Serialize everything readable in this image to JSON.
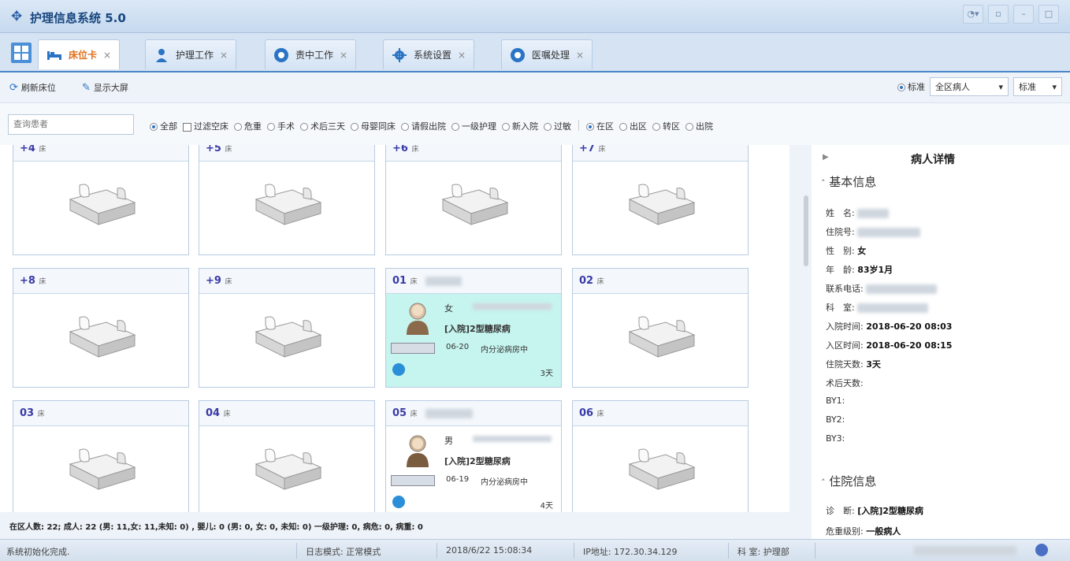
{
  "window": {
    "title": "护理信息系统 5.0"
  },
  "tabs": [
    {
      "label": "床位卡",
      "icon": "bed-icon"
    },
    {
      "label": "护理工作",
      "icon": "nurse-icon"
    },
    {
      "label": "责中工作",
      "icon": "circle-icon"
    },
    {
      "label": "系统设置",
      "icon": "gear-icon"
    },
    {
      "label": "医嘱处理",
      "icon": "circle-icon"
    }
  ],
  "toolbar": {
    "refresh_label": "刷新床位",
    "display_label": "显示大屏",
    "standard_radio": "标准",
    "patients_select": "全区病人",
    "mode_select": "标准"
  },
  "filter": {
    "search_placeholder": "查询患者",
    "options": [
      "全部",
      "过滤空床",
      "危重",
      "手术",
      "术后三天",
      "母婴同床",
      "请假出院",
      "一级护理",
      "新入院",
      "过敏",
      "在区",
      "出区",
      "转区",
      "出院"
    ]
  },
  "beds": [
    {
      "num": "+4",
      "unit": "床"
    },
    {
      "num": "+5",
      "unit": "床"
    },
    {
      "num": "+6",
      "unit": "床"
    },
    {
      "num": "+7",
      "unit": "床"
    },
    {
      "num": "+8",
      "unit": "床"
    },
    {
      "num": "+9",
      "unit": "床"
    },
    {
      "num": "01",
      "unit": "床",
      "gender": "女",
      "diagnosis": "[入院]2型糖尿病",
      "date": "06-20",
      "dept": "内分泌病房中",
      "days": "3天"
    },
    {
      "num": "02",
      "unit": "床"
    },
    {
      "num": "03",
      "unit": "床"
    },
    {
      "num": "04",
      "unit": "床"
    },
    {
      "num": "05",
      "unit": "床",
      "gender": "男",
      "diagnosis": "[入院]2型糖尿病",
      "date": "06-19",
      "dept": "内分泌病房中",
      "days": "4天"
    },
    {
      "num": "06",
      "unit": "床"
    }
  ],
  "detail": {
    "title": "病人详情",
    "basic_header": "基本信息",
    "name_label": "姓　名:",
    "admission_no_label": "住院号:",
    "gender_label": "性　别:",
    "gender_value": "女",
    "age_label": "年　龄:",
    "age_value": "83岁",
    "age_suffix": "1月",
    "phone_label": "联系电话:",
    "dept_label": "科　室:",
    "admit_time_label": "入院时间:",
    "admit_time_value": "2018-06-20 08:03",
    "ward_time_label": "入区时间:",
    "ward_time_value": "2018-06-20 08:15",
    "stay_days_label": "住院天数:",
    "stay_days_value": "3天",
    "postop_days_label": "术后天数:",
    "by1_label": "BY1:",
    "by2_label": "BY2:",
    "by3_label": "BY3:",
    "stay_header": "住院信息",
    "diag_label": "诊　断:",
    "diag_value": "[入院]2型糖尿病",
    "critical_label": "危重级别:",
    "critical_value": "一般病人"
  },
  "summary": "在区人数: 22; 成人: 22 (男: 11,女: 11,未知: 0) , 婴儿: 0 (男: 0, 女: 0, 未知: 0) 一级护理: 0, 病危: 0, 病重: 0",
  "status": {
    "message": "系统初始化完成.",
    "log_mode": "日志模式: 正常模式",
    "datetime": "2018/6/22 15:08:34",
    "ip": "IP地址: 172.30.34.129",
    "dept": "科 室: 护理部"
  }
}
